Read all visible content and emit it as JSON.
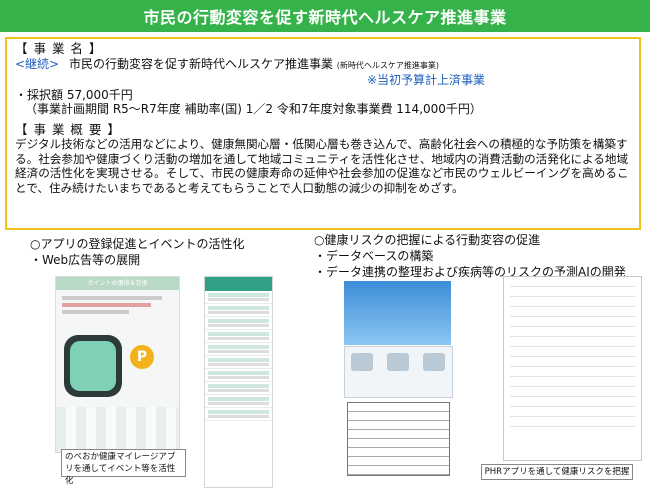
{
  "banner": {
    "title": "市民の行動変容を促す新時代ヘルスケア推進事業"
  },
  "project": {
    "name_label": "【 事 業 名 】",
    "continuation": "<継続>",
    "name": "市民の行動変容を促す新時代ヘルスケア推進事業",
    "name_sub": "(新時代ヘルスケア推進事業)",
    "budget_note": "※当初予算計上済事業",
    "adopted_amount": "・採択額 57,000千円",
    "period_line": "（事業計画期間 R5～R7年度 補助率(国) 1／2  令和7年度対象事業費 114,000千円）",
    "overview_label": "【 事 業 概 要 】",
    "overview_text": "デジタル技術などの活用などにより、健康無関心層・低関心層も巻き込んで、高齢化社会への積極的な予防策を構築する。社会参加や健康づくり活動の増加を通して地域コミュニティを活性化させ、地域内の消費活動の活発化による地域経済の活性化を実現させる。そして、市民の健康寿命の延伸や社会参加の促進など市民のウェルビーイングを高めることで、住み続けたいまちであると考えてもらうことで人口動態の減少の抑制をめざす。"
  },
  "left_section": {
    "heading": "○アプリの登録促進とイベントの活性化",
    "bullet": "・Web広告等の展開",
    "app_header": "ポイントの獲得＆交換",
    "app_coin": "P",
    "caption": "のべおか健康マイレージアプリを通してイベント等を活性化"
  },
  "right_section": {
    "heading": "○健康リスクの把握による行動変容の促進",
    "bullet1": "・データベースの構築",
    "bullet2": "・データ連携の整理および疾病等のリスクの予測AIの開発",
    "caption": "PHRアプリを通して健康リスクを把握"
  },
  "colors": {
    "banner": "#35b34a",
    "box_border": "#f0c419",
    "accent_blue": "#1f5fbf"
  }
}
